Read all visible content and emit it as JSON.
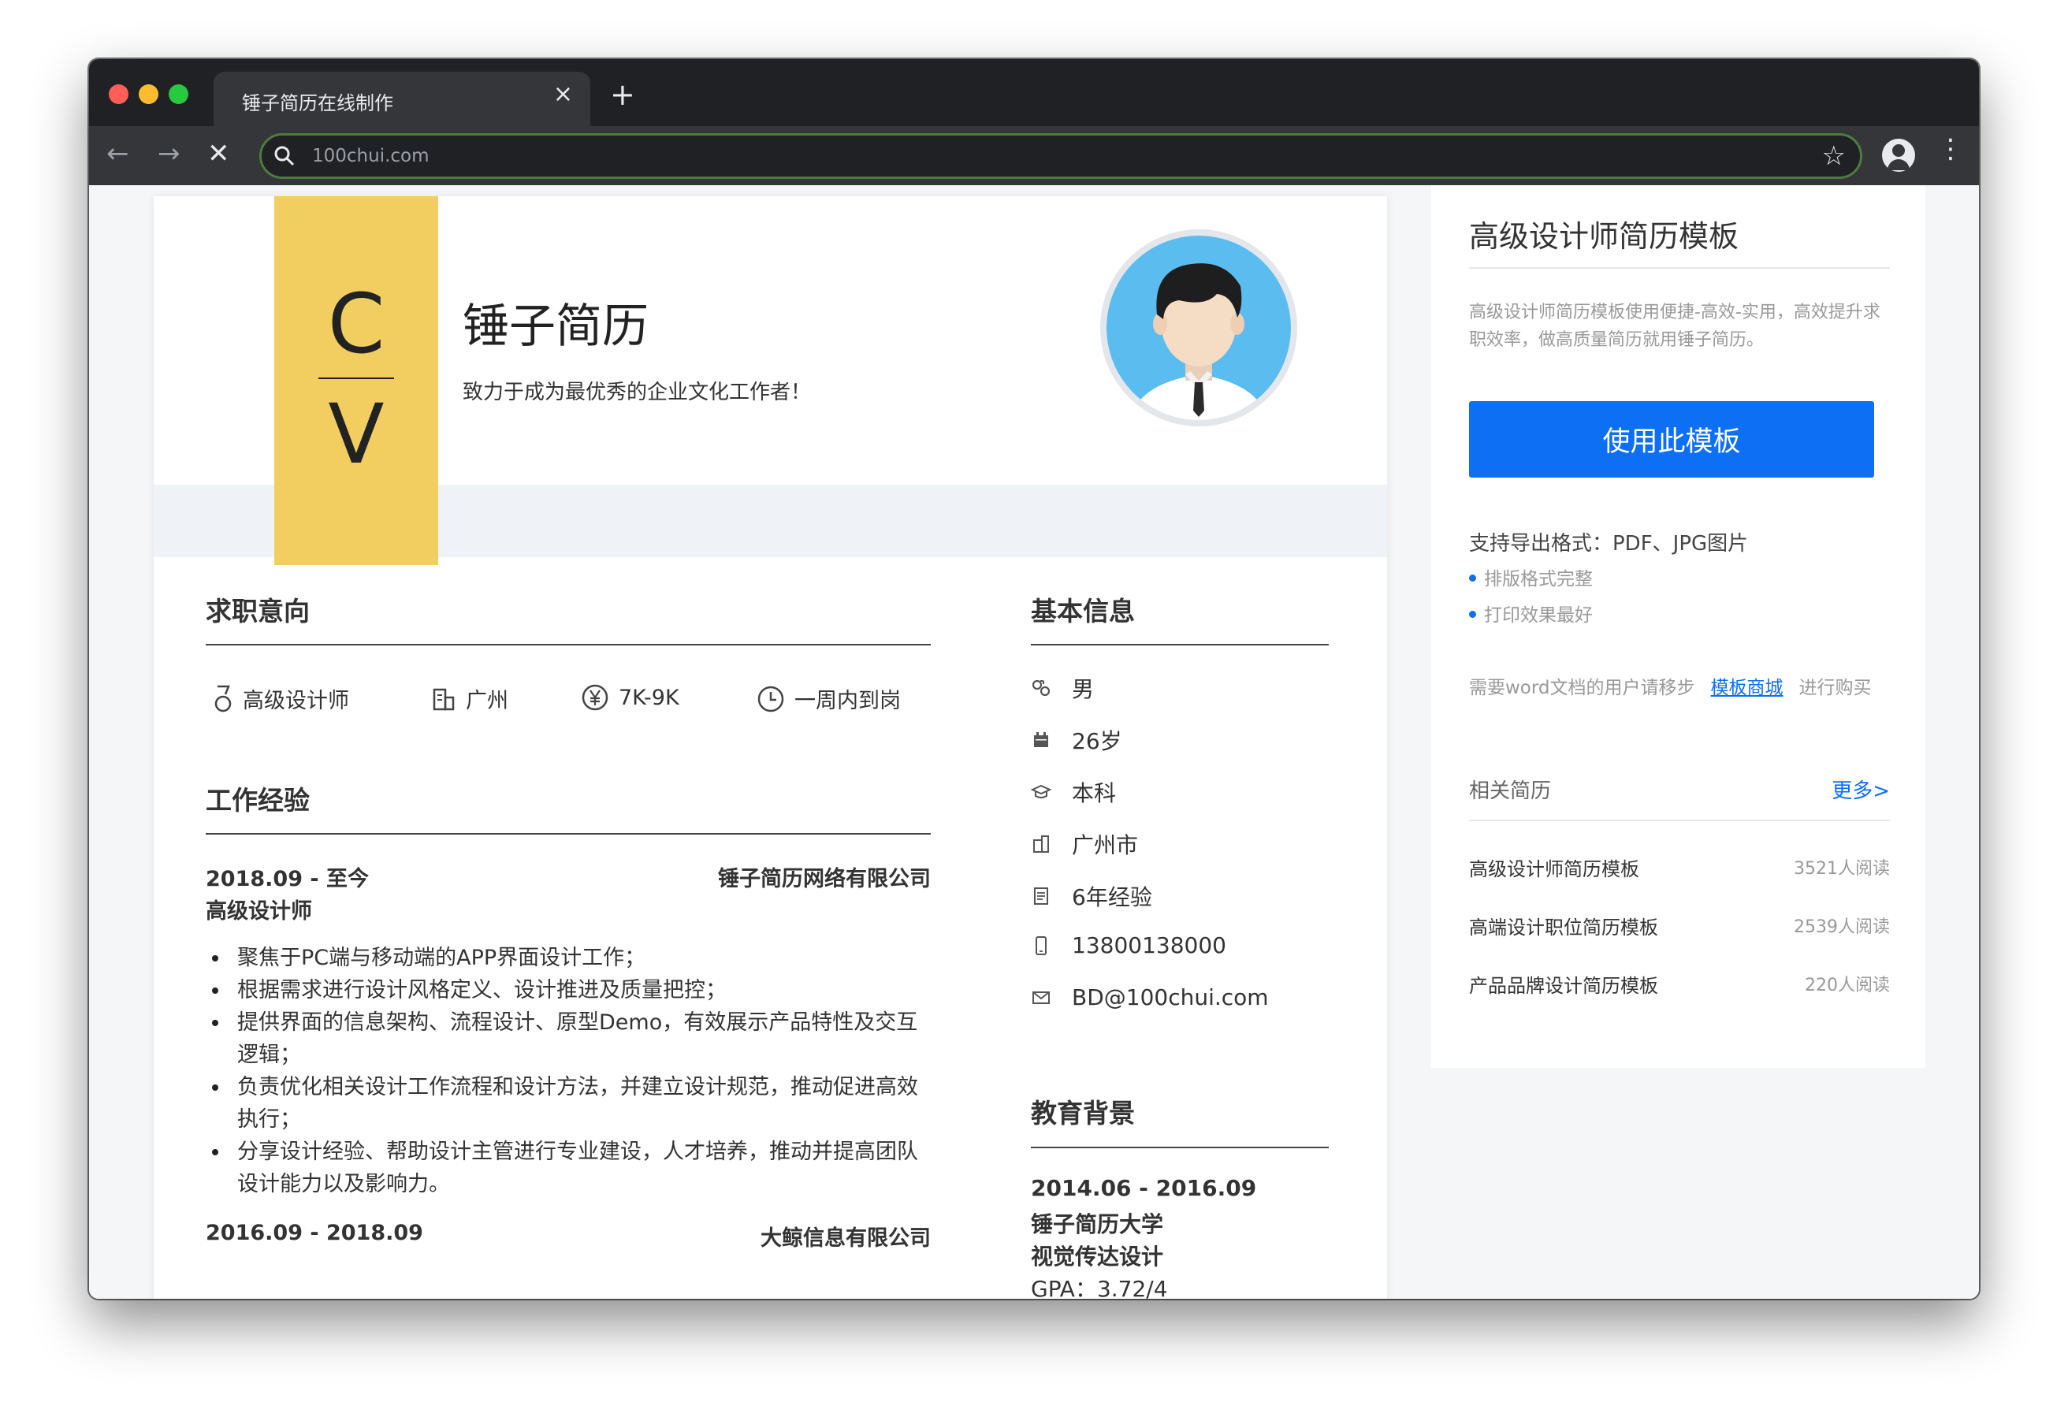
{
  "browser": {
    "tab_title": "锤子简历在线制作",
    "tab_close": "×",
    "new_tab": "+",
    "url": "100chui.com",
    "back": "←",
    "forward": "→",
    "stop": "✕",
    "star": "☆",
    "menu": "⋮"
  },
  "resume": {
    "cv_top": "C",
    "cv_bottom": "V",
    "name": "锤子简历",
    "motto": "致力于成为最优秀的企业文化工作者！",
    "intent": {
      "title": "求职意向",
      "position": "高级设计师",
      "city": "广州",
      "salary": "7K-9K",
      "availability": "一周内到岗"
    },
    "work": {
      "title": "工作经验",
      "jobs": [
        {
          "period": "2018.09 - 至今",
          "company": "锤子简历网络有限公司",
          "role": "高级设计师",
          "bullets": [
            "聚焦于PC端与移动端的APP界面设计工作；",
            "根据需求进行设计风格定义、设计推进及质量把控；",
            "提供界面的信息架构、流程设计、原型Demo，有效展示产品特性及交互逻辑；",
            "负责优化相关设计工作流程和设计方法，并建立设计规范，推动促进高效执行；",
            "分享设计经验、帮助设计主管进行专业建设，人才培养，推动并提高团队设计能力以及影响力。"
          ]
        },
        {
          "period": "2016.09 - 2018.09",
          "company": "大鲸信息有限公司"
        }
      ]
    },
    "basic": {
      "title": "基本信息",
      "gender": "男",
      "age": "26岁",
      "degree": "本科",
      "city": "广州市",
      "experience": "6年经验",
      "phone": "13800138000",
      "email": "BD@100chui.com"
    },
    "education": {
      "title": "教育背景",
      "period": "2014.06 - 2016.09",
      "school": "锤子简历大学",
      "major": "视觉传达设计",
      "gpa": "GPA：3.72/4"
    }
  },
  "sidebar": {
    "title": "高级设计师简历模板",
    "description": "高级设计师简历模板使用便捷-高效-实用，高效提升求职效率，做高质量简历就用锤子简历。",
    "use_button": "使用此模板",
    "formats": "支持导出格式：PDF、JPG图片",
    "features": [
      "排版格式完整",
      "打印效果最好"
    ],
    "note_prefix": "需要word文档的用户请移步",
    "note_link": "模板商城",
    "note_suffix": "进行购买",
    "related_title": "相关简历",
    "more": "更多>",
    "related": [
      {
        "title": "高级设计师简历模板",
        "reads": "3521人阅读"
      },
      {
        "title": "高端设计职位简历模板",
        "reads": "2539人阅读"
      },
      {
        "title": "产品品牌设计简历模板",
        "reads": "220人阅读"
      }
    ],
    "colors": {
      "accent": "#0c6ff4",
      "cv_block": "#f2cd60"
    }
  }
}
